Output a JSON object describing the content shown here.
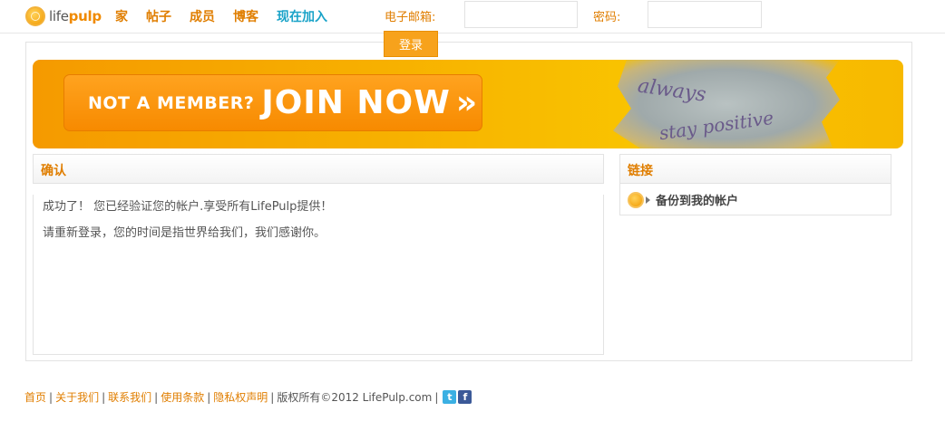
{
  "header": {
    "logo": {
      "text_plain": "life",
      "text_bold": "pulp"
    },
    "nav": [
      {
        "label": "家"
      },
      {
        "label": "帖子"
      },
      {
        "label": "成员"
      },
      {
        "label": "博客"
      },
      {
        "label": "现在加入"
      }
    ],
    "email_label": "电子邮箱:",
    "email_value": "",
    "password_label": "密码:",
    "password_value": "",
    "login_label": "登录"
  },
  "banner": {
    "small_text": "NOT A MEMBER?",
    "big_text": "JOIN NOW",
    "arrows": "»",
    "scrap_text_1": "always",
    "scrap_text_2": "stay positive"
  },
  "confirm": {
    "title": "确认",
    "line1": "成功了！ 您已经验证您的帐户.享受所有LifePulp提供！",
    "line2": "请重新登录，您的时间是指世界给我们，我们感谢你。"
  },
  "links": {
    "title": "链接",
    "items": [
      {
        "label": "备份到我的帐户"
      }
    ]
  },
  "footer": {
    "links": [
      "首页",
      "关于我们",
      "联系我们",
      "使用条款",
      "隐私权声明"
    ],
    "copyright": "版权所有©2012 LifePulp.com",
    "social": [
      {
        "icon": "twitter-icon",
        "glyph": "t"
      },
      {
        "icon": "facebook-icon",
        "glyph": "f"
      }
    ]
  },
  "colors": {
    "accent": "#e07e00",
    "join": "#1aa3c8",
    "button": "#f7a21c"
  }
}
